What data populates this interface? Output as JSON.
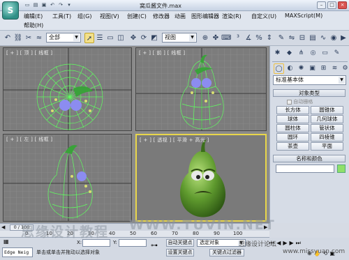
{
  "title": {
    "app_logo": "S",
    "file_name": "窝瓜酱文件.max",
    "quick_access_icons": [
      "new-icon",
      "open-icon",
      "save-icon",
      "undo-icon",
      "redo-icon",
      "dropdown-icon"
    ]
  },
  "menu": {
    "row1": [
      "编辑(E)",
      "工具(T)",
      "组(G)",
      "视图(V)",
      "创建(C)",
      "修改器",
      "动画",
      "图形编辑器",
      "渲染(R)",
      "自定义(U)",
      "MAXScript(M)"
    ],
    "row2": [
      "帮助(H)"
    ]
  },
  "toolbar": {
    "selection_filter": "全部",
    "reference_coord": "视图"
  },
  "viewports": [
    {
      "label": "[ + ] [ 顶 ] [ 线框 ]"
    },
    {
      "label": "[ + ] [ 前 ] [ 线框 ]"
    },
    {
      "label": "[ + ] [ 左 ] [ 线框 ]"
    },
    {
      "label": "[ + ] [ 透视 ] [ 平滑 + 高光 ]"
    }
  ],
  "command_panel": {
    "category_dropdown": "标准基本体",
    "object_type_title": "对象类型",
    "autogrid_label": "自动栅格",
    "object_buttons": [
      "长方体",
      "圆锥体",
      "球体",
      "几何球体",
      "圆柱体",
      "管状体",
      "圆环",
      "四棱锥",
      "茶壶",
      "平面"
    ],
    "name_color_title": "名称和颜色"
  },
  "timeline": {
    "frame_display": "0 / 100",
    "ticks": [
      "0",
      "10",
      "20",
      "30",
      "40",
      "50",
      "60",
      "70",
      "80",
      "90",
      "100"
    ]
  },
  "status": {
    "script_listener": "Edge Neig",
    "coord_x_label": "X:",
    "coord_y_label": "Y:",
    "prompt_text": "单击或单击并拖动以选择对象",
    "auto_key_label": "自动关键点",
    "set_key_label": "设置关键点",
    "selection_set": "选定对象",
    "key_filters_label": "关键点过滤器"
  },
  "watermarks": [
    "思缘设计教程",
    "WWW.TUVIN.NET",
    "思缘设计论坛",
    "www.missyuan.com"
  ],
  "colors": {
    "active_viewport_border": "#e8d64a",
    "wireframe": "#5fff5f",
    "object_color_swatch": "#8fe06a"
  }
}
